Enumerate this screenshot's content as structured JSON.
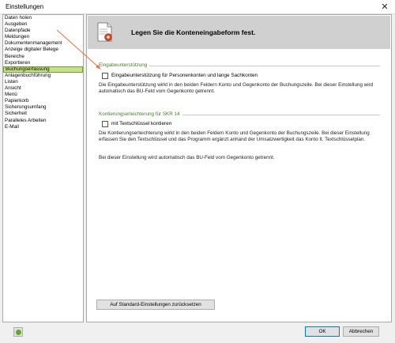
{
  "window": {
    "title": "Einstellungen",
    "close_glyph": "✕"
  },
  "sidebar": {
    "items": [
      {
        "label": "Daten holen"
      },
      {
        "label": "Ausgeben"
      },
      {
        "label": "Datenpfade"
      },
      {
        "label": "Meldungen"
      },
      {
        "label": "Dokumentenmanagement"
      },
      {
        "label": "Anzeige digitaler Belege"
      },
      {
        "label": "Bereiche"
      },
      {
        "label": "Exportieren"
      },
      {
        "label": "Buchungserfassung"
      },
      {
        "label": "Anlagenbuchführung"
      },
      {
        "label": "Listen"
      },
      {
        "label": "Ansicht"
      },
      {
        "label": "Menü"
      },
      {
        "label": "Papierkorb"
      },
      {
        "label": "Sicherungsumfang"
      },
      {
        "label": "Sicherheit"
      },
      {
        "label": "Paralleles Arbeiten"
      },
      {
        "label": "E-Mail"
      }
    ],
    "selected_index": 8
  },
  "header": {
    "title": "Legen Sie die Konteneingabeform fest.",
    "icon": "document-settings-icon"
  },
  "group1": {
    "label": "Eingabeunterstützung",
    "checkbox_label": "Eingabeunterstützung für Personenkonten und lange Sachkonten",
    "checked": false,
    "description": "Die Eingabeunterstützung wirkt in den beiden Feldern Konto und Gegenkonto der Buchungszeile. Bei dieser Einstellung wird automatisch das BU-Feld vom Gegenkonto getrennt."
  },
  "group2": {
    "label": "Kontierungserleichterung für SKR 14",
    "checkbox_label": "mit Textschlüssel kontieren",
    "checked": false,
    "description": "Die Kontierungserleichterung wirkt in den beiden Feldern Konto und Gegenkonto der Buchungszeile. Bei dieser Einstellung erfassen Sie den Textschlüssel und das Programm ergänzt anhand der Umsatzwertigkeit das Konto lt. Textschlüsselplan.",
    "description2": "Bei dieser Einstellung wird automatisch das BU-Feld vom Gegenkonto getrennt."
  },
  "buttons": {
    "reset": "Auf Standard-Einstellungen zurücksetzen",
    "ok": "OK",
    "cancel": "Abbrechen"
  },
  "colors": {
    "accent_green": "#4a7a2a",
    "selection": "#c5e08a",
    "annotation_arrow": "#e8703a"
  }
}
